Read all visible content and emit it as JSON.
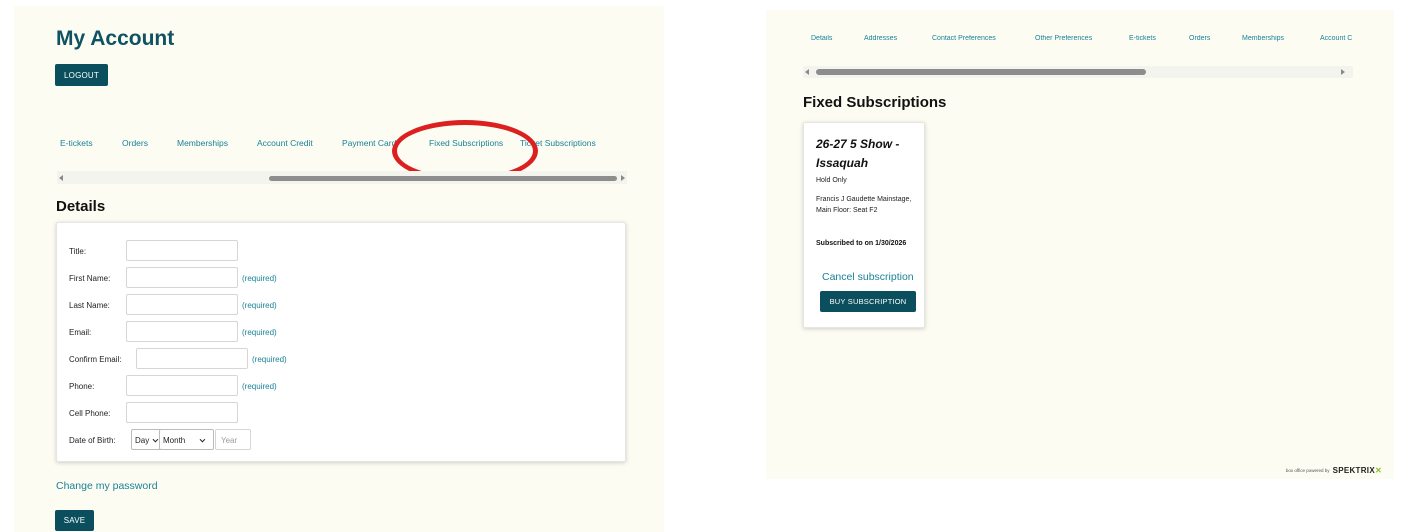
{
  "account": {
    "title": "My Account",
    "logout_label": "LOGOUT",
    "tabs": [
      "E-tickets",
      "Orders",
      "Memberships",
      "Account Credit",
      "Payment Card",
      "Fixed Subscriptions",
      "Ticket Subscriptions"
    ],
    "details_title": "Details",
    "form": {
      "title_label": "Title:",
      "first_name_label": "First Name:",
      "last_name_label": "Last Name:",
      "email_label": "Email:",
      "confirm_email_label": "Confirm Email:",
      "phone_label": "Phone:",
      "cell_phone_label": "Cell Phone:",
      "dob_label": "Date of Birth:",
      "required_text": "(required)",
      "day_value": "Day",
      "month_value": "Month",
      "year_placeholder": "Year"
    },
    "change_password": "Change my password",
    "save_label": "SAVE"
  },
  "subscriptions": {
    "tabs": [
      "Details",
      "Addresses",
      "Contact Preferences",
      "Other Preferences",
      "E-tickets",
      "Orders",
      "Memberships",
      "Account C"
    ],
    "title": "Fixed Subscriptions",
    "card": {
      "name": "26-27 5 Show - Issaquah",
      "status": "Hold Only",
      "seat": "Francis J Gaudette Mainstage, Main Floor: Seat F2",
      "subscribed": "Subscribed to on 1/30/2026",
      "cancel": "Cancel subscription",
      "buy": "BUY SUBSCRIPTION"
    },
    "powered_by": "box office powered by",
    "brand": "SPEKTRIX"
  },
  "colors": {
    "accent": "#0b4f5e",
    "link": "#1a8298",
    "highlight_circle": "#dc1f1f"
  }
}
